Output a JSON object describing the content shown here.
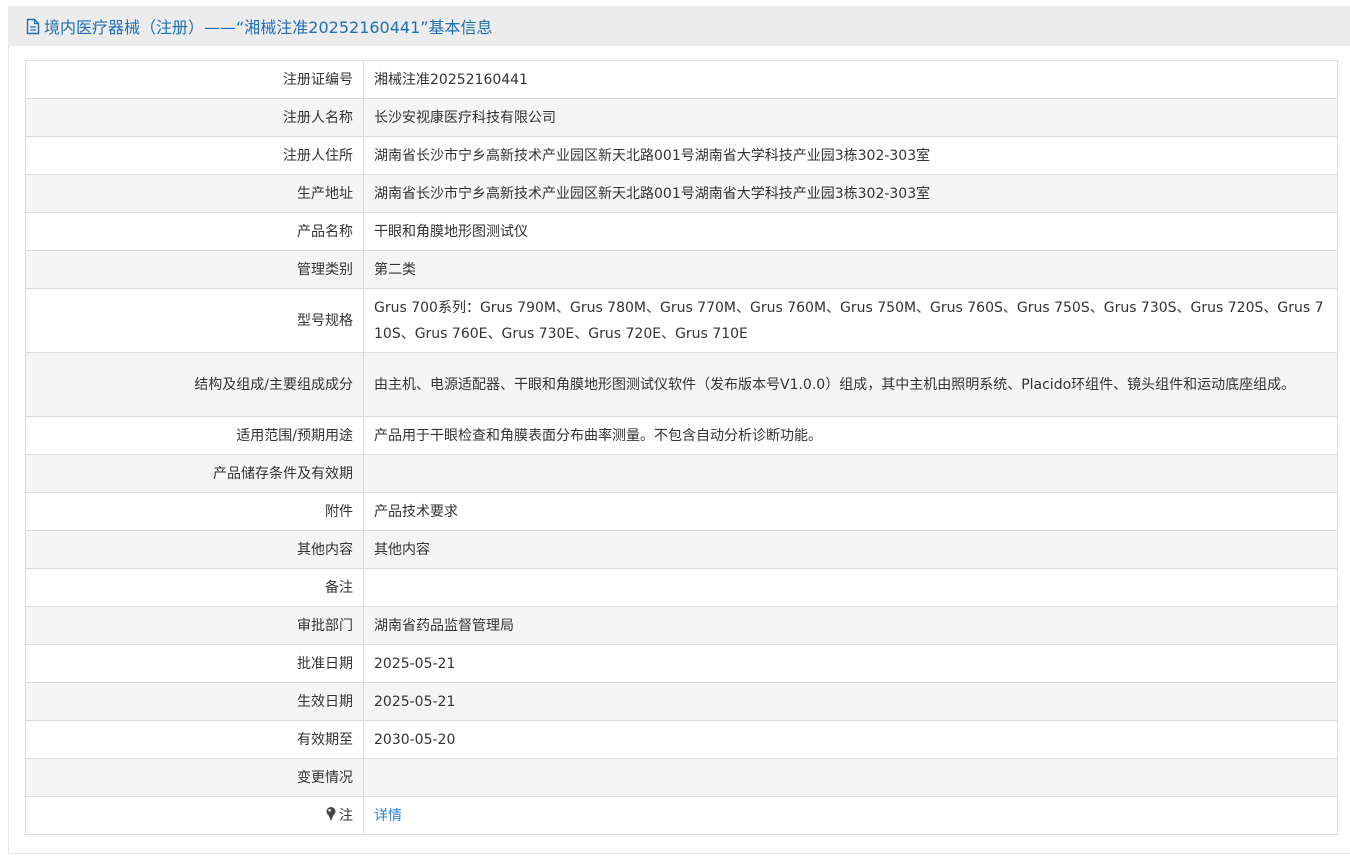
{
  "header": {
    "title": "境内医疗器械（注册）——“湘械注准20252160441”基本信息"
  },
  "colors": {
    "title": "#1f6fb5",
    "link": "#2b84d6",
    "row_alt": "#f5f5f5",
    "border": "#dcdcdc"
  },
  "rows": [
    {
      "label": "注册证编号",
      "value": "湘械注准20252160441"
    },
    {
      "label": "注册人名称",
      "value": "长沙安视康医疗科技有限公司"
    },
    {
      "label": "注册人住所",
      "value": "湖南省长沙市宁乡高新技术产业园区新天北路001号湖南省大学科技产业园3栋302-303室"
    },
    {
      "label": "生产地址",
      "value": "湖南省长沙市宁乡高新技术产业园区新天北路001号湖南省大学科技产业园3栋302-303室"
    },
    {
      "label": "产品名称",
      "value": "干眼和角膜地形图测试仪"
    },
    {
      "label": "管理类别",
      "value": "第二类"
    },
    {
      "label": "型号规格",
      "value": "Grus 700系列：Grus 790M、Grus 780M、Grus 770M、Grus 760M、Grus 750M、Grus 760S、Grus 750S、Grus 730S、Grus 720S、Grus 710S、Grus 760E、Grus 730E、Grus 720E、Grus 710E"
    },
    {
      "label": "结构及组成/主要组成成分",
      "value": "由主机、电源适配器、干眼和角膜地形图测试仪软件（发布版本号V1.0.0）组成，其中主机由照明系统、Placido环组件、镜头组件和运动底座组成。"
    },
    {
      "label": "适用范围/预期用途",
      "value": "产品用于干眼检查和角膜表面分布曲率测量。不包含自动分析诊断功能。"
    },
    {
      "label": "产品储存条件及有效期",
      "value": ""
    },
    {
      "label": "附件",
      "value": "产品技术要求"
    },
    {
      "label": "其他内容",
      "value": "其他内容"
    },
    {
      "label": "备注",
      "value": ""
    },
    {
      "label": "审批部门",
      "value": "湖南省药品监督管理局"
    },
    {
      "label": "批准日期",
      "value": "2025-05-21"
    },
    {
      "label": "生效日期",
      "value": "2025-05-21"
    },
    {
      "label": "有效期至",
      "value": "2030-05-20"
    },
    {
      "label": "变更情况",
      "value": ""
    },
    {
      "label": "注",
      "value": "详情"
    }
  ]
}
